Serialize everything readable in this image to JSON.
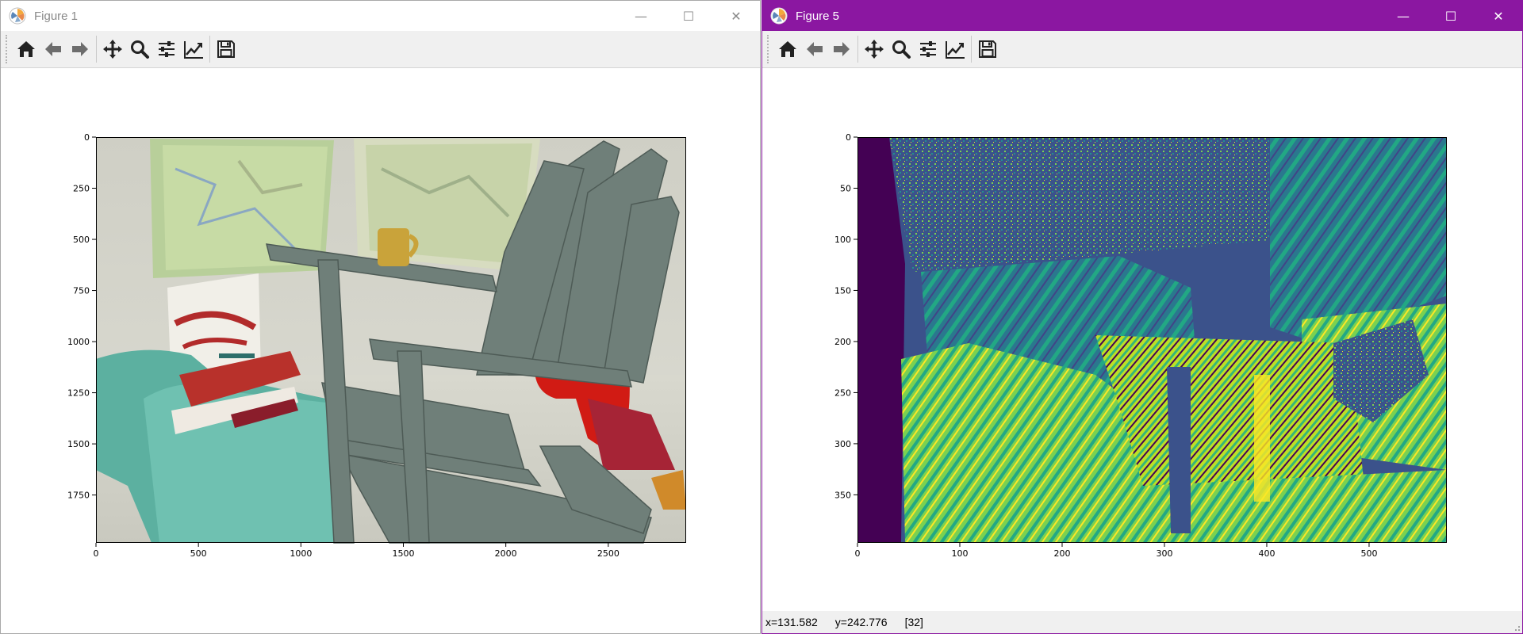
{
  "windows": [
    {
      "title": "Figure 1",
      "controls": {
        "minimize": "—",
        "maximize": "☐",
        "close": "✕"
      },
      "toolbar": [
        "home-icon",
        "back-icon",
        "forward-icon",
        "pan-icon",
        "zoom-icon",
        "configure-subplots-icon",
        "edit-axes-icon",
        "save-icon"
      ]
    },
    {
      "title": "Figure 5",
      "controls": {
        "minimize": "—",
        "maximize": "☐",
        "close": "✕"
      },
      "toolbar": [
        "home-icon",
        "back-icon",
        "forward-icon",
        "pan-icon",
        "zoom-icon",
        "configure-subplots-icon",
        "edit-axes-icon",
        "save-icon"
      ],
      "status": {
        "x": "x=131.582",
        "y": "y=242.776",
        "value": "[32]"
      }
    }
  ],
  "colors": {
    "active_titlebar": "#8b17a1",
    "icon_dark": "#222222",
    "icon_gray": "#6d6d6d"
  },
  "chart_data": [
    {
      "type": "image",
      "content": "photo of green wooden Adirondack chair with books, mug, red scarf and maps",
      "xticks": [
        0,
        500,
        1000,
        1500,
        2000,
        2500
      ],
      "yticks": [
        0,
        250,
        500,
        750,
        1000,
        1250,
        1500,
        1750
      ],
      "xlim": [
        0,
        2880
      ],
      "ylim": [
        1984,
        0
      ]
    },
    {
      "type": "heatmap",
      "colormap": "viridis",
      "xticks": [
        0,
        100,
        200,
        300,
        400,
        500
      ],
      "yticks": [
        0,
        50,
        100,
        150,
        200,
        250,
        300,
        350
      ],
      "xlim": [
        0,
        576
      ],
      "ylim": [
        397,
        0
      ]
    }
  ]
}
